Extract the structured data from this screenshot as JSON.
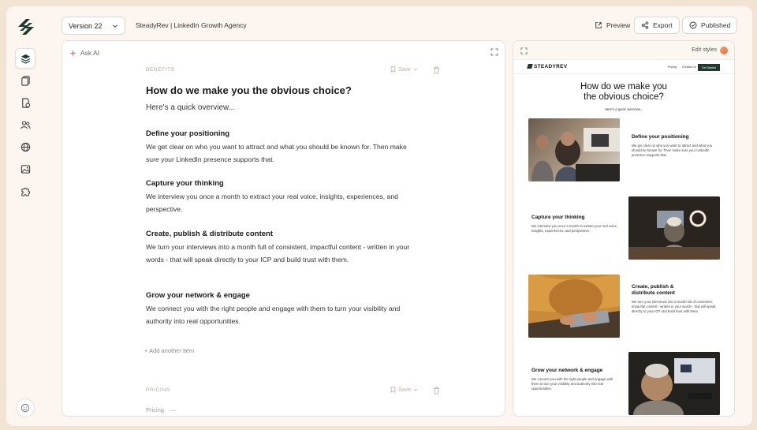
{
  "colors": {
    "background": "#f3e3d2",
    "accent_green": "#1d3a2f",
    "brand_logo": "#1d3a2f"
  },
  "sidebar": {
    "items": [
      {
        "icon": "layers-icon"
      },
      {
        "icon": "pages-icon"
      },
      {
        "icon": "assets-icon"
      },
      {
        "icon": "users-icon"
      },
      {
        "icon": "globe-icon"
      },
      {
        "icon": "image-icon"
      },
      {
        "icon": "puzzle-icon"
      }
    ]
  },
  "topbar": {
    "version": "Version 22",
    "doc_title": "SteadyRev | LinkedIn Growth Agency",
    "preview_label": "Preview",
    "export_label": "Export",
    "published_label": "Published"
  },
  "editor": {
    "ask_ai": "Ask AI",
    "section_label": "BENEFITS",
    "save_label": "Save",
    "title": "How do we make you the obvious choice?",
    "subtitle": "Here's a quick overview...",
    "items": [
      {
        "heading": "Define your positioning",
        "body": "We get clear on who you want to attract and what you should be known for. Then make sure your LinkedIn presence supports that."
      },
      {
        "heading": "Capture your thinking",
        "body": "We interview you once a month to extract your real voice, insights, experiences, and perspective."
      },
      {
        "heading": "Create, publish & distribute content",
        "body": "We turn your interviews into a month full of consistent, impactful content - written in your words - that will speak directly to your ICP and build trust with them."
      },
      {
        "heading": "Grow your network & engage",
        "body": "We connect you with the right people and engage with them to turn your visibility and authority into real opportunities."
      }
    ],
    "add_item": "+ Add another item",
    "next_section_label": "PRICING",
    "next_section_save": "Save",
    "pricing_field": "Pricing",
    "pricing_value": "—"
  },
  "preview": {
    "edit_styles": "Edit styles",
    "site_logo": "STEADYREV",
    "nav_links": [
      "Pricing",
      "Contact Us"
    ],
    "nav_cta": "Get Started",
    "title_line1": "How do we make you",
    "title_line2": "the obvious choice?",
    "subtitle": "Here's a quick overview...",
    "items": [
      {
        "heading": "Define your positioning",
        "body": "We get clear on who you want to attract and what you should be known for. Then make sure your LinkedIn presence supports that."
      },
      {
        "heading": "Capture your thinking",
        "body": "We interview you once a month to extract your real voice, insights, experiences, and perspective."
      },
      {
        "heading": "Create, publish & distribute content",
        "body": "We turn your interviews into a month full of consistent, impactful content - written in your words - that will speak directly to your ICP and build trust with them."
      },
      {
        "heading": "Grow your network & engage",
        "body": "We connect you with the right people and engage with them to turn your visibility and authority into real opportunities."
      }
    ]
  }
}
